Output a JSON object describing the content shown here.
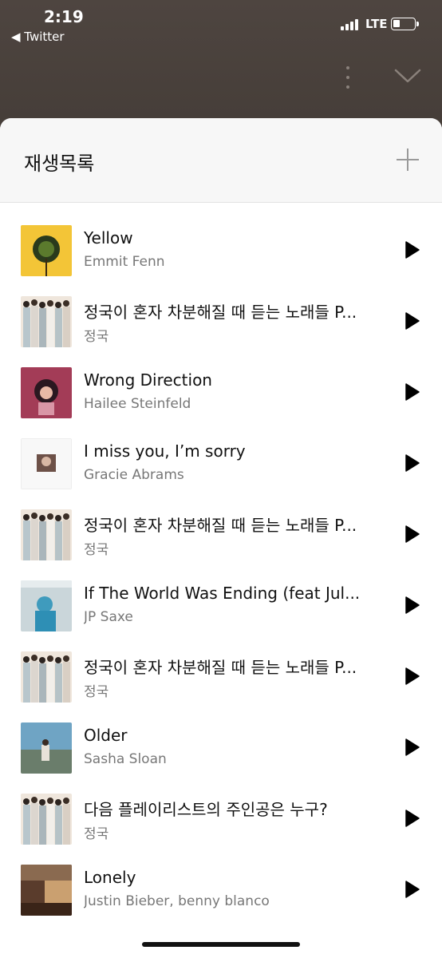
{
  "status": {
    "time": "2:19",
    "back_app": "◀ Twitter",
    "network": "LTE"
  },
  "header": {
    "more_icon": "more-vertical-icon",
    "collapse_icon": "chevron-down-icon"
  },
  "sheet": {
    "title": "재생목록",
    "add_icon": "plus-icon",
    "tracks": [
      {
        "title": "Yellow",
        "artist": "Emmit Fenn",
        "art": "yellow-flower"
      },
      {
        "title": "정국이 혼자 차분해질 때 듣는 노래들 P...",
        "artist": "정국",
        "art": "group-photo"
      },
      {
        "title": "Wrong Direction",
        "artist": "Hailee Steinfeld",
        "art": "pink-portrait"
      },
      {
        "title": "I miss you, I’m sorry",
        "artist": "Gracie Abrams",
        "art": "white-photo"
      },
      {
        "title": "정국이 혼자 차분해질 때 듣는 노래들 P...",
        "artist": "정국",
        "art": "group-photo"
      },
      {
        "title": "If The World Was Ending (feat Jul...",
        "artist": "JP Saxe",
        "art": "light-blue"
      },
      {
        "title": "정국이 혼자 차분해질 때 듣는 노래들 P...",
        "artist": "정국",
        "art": "group-photo"
      },
      {
        "title": "Older",
        "artist": "Sasha Sloan",
        "art": "beach"
      },
      {
        "title": "다음 플레이리스트의 주인공은 누구?",
        "artist": "정국",
        "art": "group-photo"
      },
      {
        "title": "Lonely",
        "artist": "Justin Bieber, benny blanco",
        "art": "dark-room"
      }
    ]
  }
}
